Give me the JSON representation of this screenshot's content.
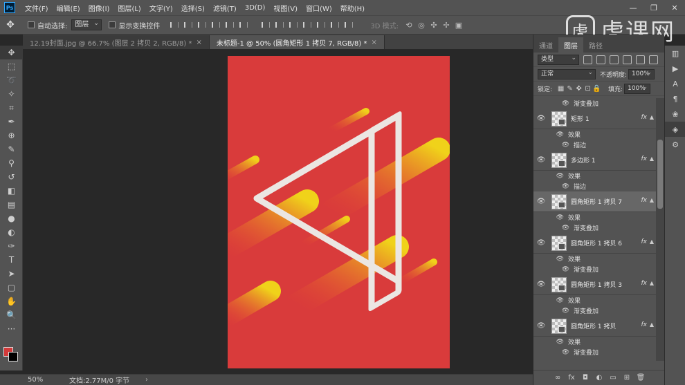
{
  "app": {
    "logo": "Ps"
  },
  "menu": [
    "文件(F)",
    "编辑(E)",
    "图像(I)",
    "图层(L)",
    "文字(Y)",
    "选择(S)",
    "滤镜(T)",
    "3D(D)",
    "视图(V)",
    "窗口(W)",
    "帮助(H)"
  ],
  "window_controls": {
    "minimize": "—",
    "restore": "❐",
    "close": "✕"
  },
  "options": {
    "auto_select_label": "自动选择:",
    "auto_select_value": "图层",
    "show_transform_label": "显示变换控件",
    "mode_3d_label": "3D 模式:"
  },
  "watermark": {
    "logo_glyph": "虎",
    "text": "虎课网"
  },
  "tabs": [
    {
      "label": "12.19封面.jpg @ 66.7% (图层 2 拷贝 2, RGB/8) *",
      "close": "×",
      "active": false
    },
    {
      "label": "未标题-1 @ 50% (圆角矩形 1 拷贝 7, RGB/8) *",
      "close": "×",
      "active": true
    }
  ],
  "status": {
    "zoom": "50%",
    "doc_info": "文档:2.77M/0 字节",
    "arrow": "›"
  },
  "panel": {
    "tabs": [
      "通道",
      "图层",
      "路径"
    ],
    "active_tab": "图层",
    "filter_kind": "类型",
    "blend_mode": "正常",
    "opacity_label": "不透明度:",
    "opacity_value": "100%",
    "lock_label": "锁定:",
    "fill_label": "填充:",
    "fill_value": "100%"
  },
  "layers_top_effect": "渐变叠加",
  "layers": [
    {
      "name": "矩形 1",
      "fx": "fx",
      "selected": false,
      "effects_label": "效果",
      "effect": "描边"
    },
    {
      "name": "多边形 1",
      "fx": "fx",
      "selected": false,
      "effects_label": "效果",
      "effect": "描边"
    },
    {
      "name": "圆角矩形 1 拷贝 7",
      "fx": "fx",
      "selected": true,
      "effects_label": "效果",
      "effect": "渐变叠加"
    },
    {
      "name": "圆角矩形 1 拷贝 6",
      "fx": "fx",
      "selected": false,
      "effects_label": "效果",
      "effect": "渐变叠加"
    },
    {
      "name": "圆角矩形 1 拷贝 3",
      "fx": "fx",
      "selected": false,
      "effects_label": "效果",
      "effect": "渐变叠加"
    },
    {
      "name": "圆角矩形 1 拷贝",
      "fx": "fx",
      "selected": false,
      "effects_label": "效果",
      "effect": "渐变叠加"
    }
  ],
  "colors": {
    "canvas_bg": "#d93b3b",
    "stripe_start": "#f0d21a",
    "stripe_end": "#e8502c",
    "outline": "#ebe6e2",
    "foreground": "#d23a3a",
    "background": "#000000"
  }
}
